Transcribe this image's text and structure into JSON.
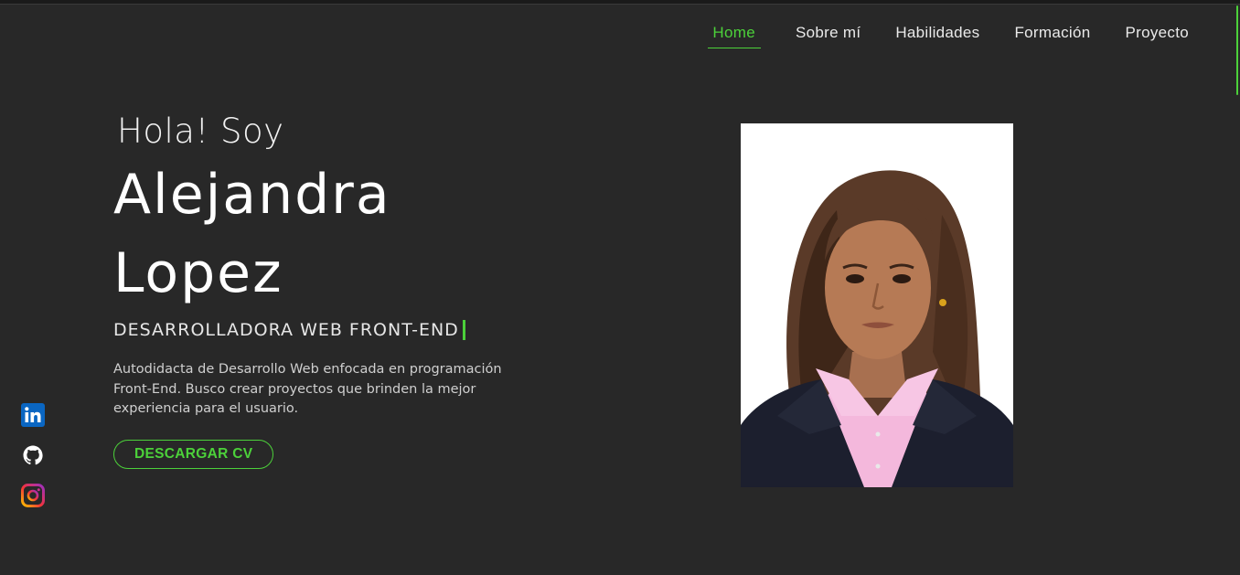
{
  "nav": {
    "items": [
      {
        "label": "Home",
        "active": true
      },
      {
        "label": "Sobre mí",
        "active": false
      },
      {
        "label": "Habilidades",
        "active": false
      },
      {
        "label": "Formación",
        "active": false
      },
      {
        "label": "Proyecto",
        "active": false
      }
    ]
  },
  "hero": {
    "greeting": "Hola! Soy",
    "first_name": "Alejandra",
    "last_name": "Lopez",
    "role": "DESARROLLADORA WEB FRONT-END",
    "description": "Autodidacta de Desarrollo Web enfocada en programación Front-End. Busco crear proyectos que brinden la mejor experiencia para el usuario.",
    "cv_button": "DESCARGAR CV"
  },
  "socials": [
    {
      "icon": "linkedin-icon"
    },
    {
      "icon": "github-icon"
    },
    {
      "icon": "instagram-icon"
    }
  ],
  "colors": {
    "accent": "#4cd13a",
    "background": "#282828",
    "text": "#e8e8e8"
  }
}
